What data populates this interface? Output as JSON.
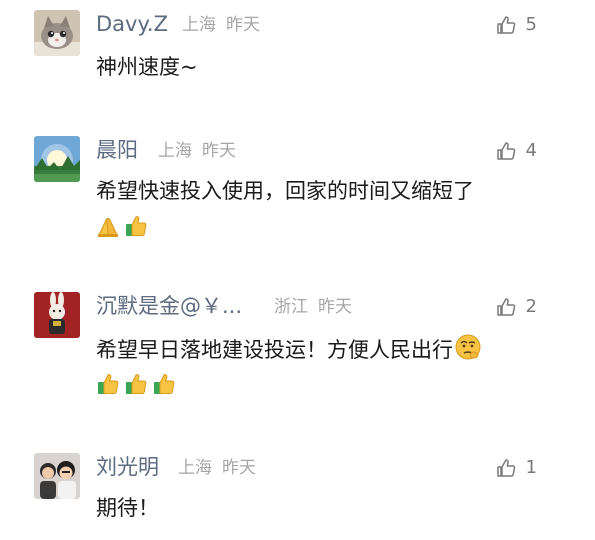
{
  "comments": [
    {
      "user": "Davy.Z",
      "location": "上海",
      "time": "昨天",
      "likes": "5",
      "text": "神州速度~",
      "emojis": []
    },
    {
      "user": "晨阳",
      "location": "上海",
      "time": "昨天",
      "likes": "4",
      "text": "希望快速投入使用，回家的时间又缩短了",
      "emojis": [
        "pray-icon",
        "thumbs-up-icon"
      ]
    },
    {
      "user": "沉默是金@￥...",
      "location": "浙江",
      "time": "昨天",
      "likes": "2",
      "text": "希望早日落地建设投运！方便人民出行",
      "emojis": [
        "thumbs-up-icon",
        "thumbs-up-icon",
        "thumbs-up-icon"
      ],
      "inline_emoji": "pondering-face-icon"
    },
    {
      "user": "刘光明",
      "location": "上海",
      "time": "昨天",
      "likes": "1",
      "text": "期待！",
      "emojis": []
    }
  ],
  "colors": {
    "username": "#5c6b80",
    "meta": "#a6a6a6",
    "text": "#1a1a1a",
    "like": "#7a7a7a",
    "emoji_yellow": "#f6c342"
  }
}
